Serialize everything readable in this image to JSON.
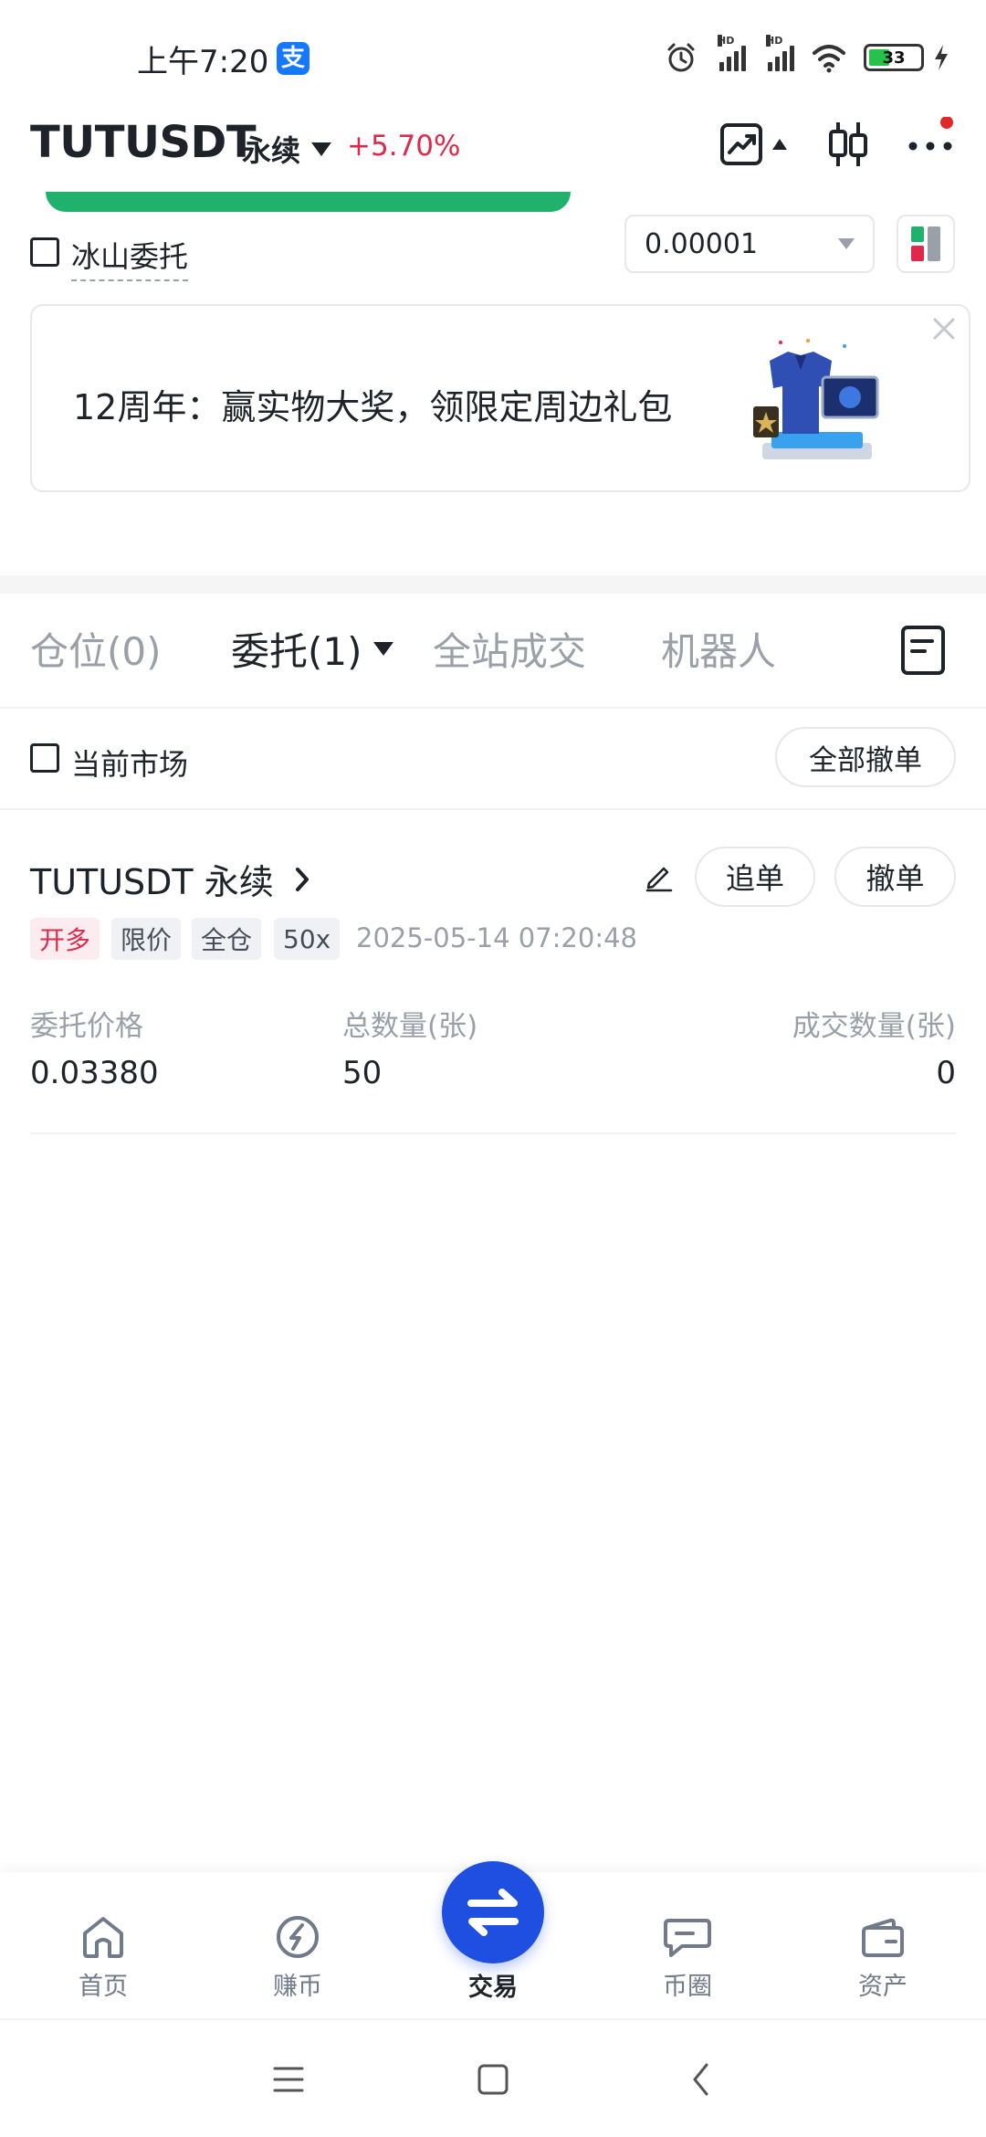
{
  "status_bar": {
    "time": "上午7:20",
    "alipay_glyph": "支",
    "hd_label": "HD",
    "battery_level": "33"
  },
  "header": {
    "symbol": "TUTUSDT",
    "contract_type": "永续",
    "change_pct": "+5.70%",
    "change_color": "#e0294a"
  },
  "order_form": {
    "iceberg_label": "冰山委托",
    "precision_value": "0.00001",
    "buy_color": "#20b26c"
  },
  "banner": {
    "text": "12周年：赢实物大奖，领限定周边礼包"
  },
  "tabs": [
    {
      "label": "仓位(0)"
    },
    {
      "label": "委托(1)"
    },
    {
      "label": "全站成交"
    },
    {
      "label": "机器人"
    }
  ],
  "filters": {
    "current_market_label": "当前市场",
    "cancel_all_label": "全部撤单"
  },
  "order": {
    "symbol_label": "TUTUSDT 永续",
    "chase_label": "追单",
    "cancel_label": "撤单",
    "tags": [
      "开多",
      "限价",
      "全仓",
      "50x"
    ],
    "time": "2025-05-14 07:20:48",
    "columns": [
      {
        "label": "委托价格",
        "value": "0.03380"
      },
      {
        "label": "总数量(张)",
        "value": "50"
      },
      {
        "label": "成交数量(张)",
        "value": "0"
      }
    ]
  },
  "bottom_nav": [
    {
      "label": "首页",
      "icon": "home-icon"
    },
    {
      "label": "赚币",
      "icon": "earn-icon"
    },
    {
      "label": "交易",
      "icon": "trade-swap-icon"
    },
    {
      "label": "币圈",
      "icon": "community-chat-icon"
    },
    {
      "label": "资产",
      "icon": "wallet-icon"
    }
  ],
  "accent_color": "#1f4fe0"
}
